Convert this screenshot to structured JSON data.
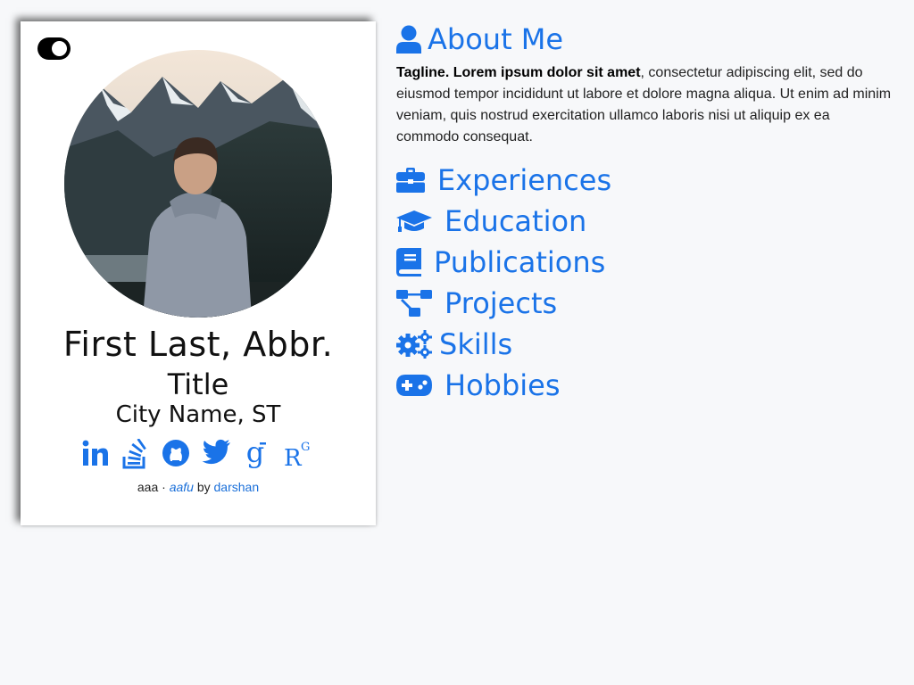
{
  "profile": {
    "name": "First Last, Abbr.",
    "title": "Title",
    "location": "City Name, ST"
  },
  "theme_toggle": {
    "state": "on"
  },
  "socials": [
    {
      "icon": "linkedin-icon"
    },
    {
      "icon": "stackoverflow-icon"
    },
    {
      "icon": "github-icon"
    },
    {
      "icon": "twitter-icon"
    },
    {
      "icon": "google-scholar-icon"
    },
    {
      "icon": "researchgate-icon",
      "text": "R",
      "sup": "G"
    }
  ],
  "footer": {
    "prefix": "aaa ·",
    "theme_link": "aafu",
    "by": "by",
    "author_link": "darshan"
  },
  "about": {
    "heading": "About Me",
    "tagline": "Tagline. Lorem ipsum dolor sit amet",
    "body": ", consectetur adipiscing elit, sed do eiusmod tempor incididunt ut labore et dolore magna aliqua. Ut enim ad minim veniam, quis nostrud exercitation ullamco laboris nisi ut aliquip ex ea commodo consequat."
  },
  "sections": [
    {
      "label": "Experiences",
      "icon": "briefcase-icon"
    },
    {
      "label": "Education",
      "icon": "graduation-cap-icon"
    },
    {
      "label": "Publications",
      "icon": "book-icon"
    },
    {
      "label": "Projects",
      "icon": "project-diagram-icon"
    },
    {
      "label": "Skills",
      "icon": "cogs-icon"
    },
    {
      "label": "Hobbies",
      "icon": "gamepad-icon"
    }
  ],
  "colors": {
    "accent": "#1a73e8",
    "link": "#1a6fd9",
    "background": "#f7f8fa"
  }
}
